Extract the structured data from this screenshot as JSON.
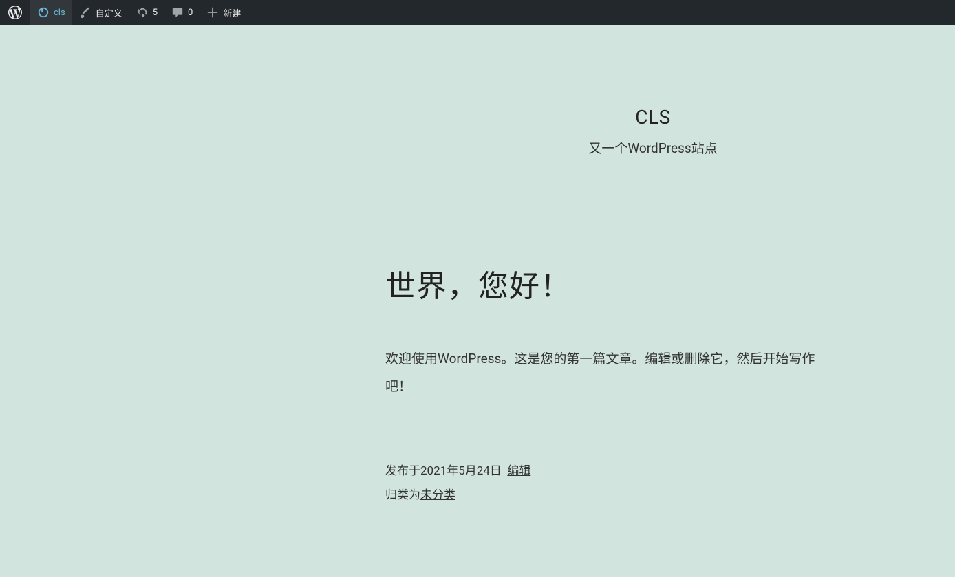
{
  "adminbar": {
    "site_name": "cls",
    "customize_label": "自定义",
    "updates_count": "5",
    "comments_count": "0",
    "new_label": "新建"
  },
  "header": {
    "site_title": "CLS",
    "tagline": "又一个WordPress站点"
  },
  "post": {
    "title": "世界，您好！",
    "excerpt": "欢迎使用WordPress。这是您的第一篇文章。编辑或删除它，然后开始写作吧！",
    "published_prefix": "发布于",
    "published_date": "2021年5月24日",
    "edit_label": "编辑",
    "category_prefix": "归类为",
    "category": "未分类"
  }
}
